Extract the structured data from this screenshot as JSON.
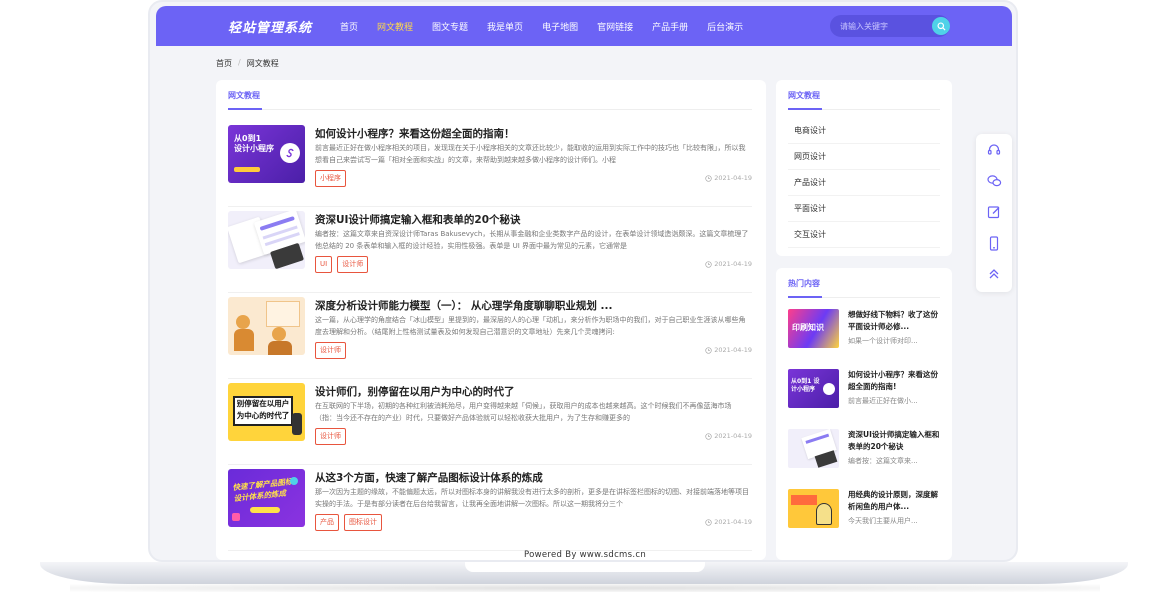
{
  "header": {
    "logo": "轻站管理系统",
    "nav": [
      {
        "label": "首页",
        "active": false
      },
      {
        "label": "网文教程",
        "active": true
      },
      {
        "label": "图文专题",
        "active": false
      },
      {
        "label": "我是单页",
        "active": false
      },
      {
        "label": "电子地图",
        "active": false
      },
      {
        "label": "官网链接",
        "active": false
      },
      {
        "label": "产品手册",
        "active": false
      },
      {
        "label": "后台演示",
        "active": false
      }
    ],
    "search_placeholder": "请输入关键字"
  },
  "breadcrumb": {
    "home": "首页",
    "sep": "/",
    "current": "网文教程"
  },
  "main": {
    "title": "网文教程",
    "articles": [
      {
        "title": "如何设计小程序？来看这份超全面的指南！",
        "desc": "前言最近正好在做小程序相关的项目，发现现在关于小程序相关的文章还比较少，能取收的运用到实际工作中的技巧也「比较有限」，所以我想看自己来尝试写一篇「相对全面和实战」的文章，来帮助到越来越多做小程序的设计师们。小程",
        "tags": [
          "小程序"
        ],
        "date": "2021-04-19",
        "thumb_text": [
          "从0到1",
          "设计小程序"
        ]
      },
      {
        "title": "资深UI设计师搞定输入框和表单的20个秘诀",
        "desc": "编者按：这篇文章来自资深设计师Taras Bakusevych，长期从事金融和企业类数字产品的设计，在表单设计领域造诣颇深。这篇文章梳理了他总结的 20 条表单和输入框的设计经验，实用性极强。表单是 UI 界面中最为常见的元素，它通常是",
        "tags": [
          "UI",
          "设计师"
        ],
        "date": "2021-04-19",
        "thumb_text": []
      },
      {
        "title": "深度分析设计师能力模型（一）： 从心理学角度聊聊职业规划 ...",
        "desc": "这一篇，从心理学的角度结合「冰山模型」里提到的，最深层的人的心理「动机」，来分析作为职场中的我们，对于自己职业生涯该从哪些角度去理解和分析。（结尾附上性格测试量表及如何发现自己潜意识的文章地址）先来几个灵魂拷问:",
        "tags": [
          "设计师"
        ],
        "date": "2021-04-19",
        "thumb_text": []
      },
      {
        "title": "设计师们，别停留在以用户为中心的时代了",
        "desc": "在互联网的下半场，初期的各种红利被消耗殆尽，用户变得越来越「伺候」，获取用户的成本也越来越高。这个时候我们不再像蓝海市场（指：当今还不存在的产业）时代，只要做好产品体验就可以轻松收获大批用户，为了生存和赚更多的",
        "tags": [
          "设计师"
        ],
        "date": "2021-04-19",
        "thumb_text": [
          "别停留在以用户",
          "为中心的时代了"
        ]
      },
      {
        "title": "从这3个方面，快速了解产品图标设计体系的炼成",
        "desc": "那一次因为主题的缘故，不能偏题太远，所以对图标本身的讲解我没有进行太多的剖析，更多是在讲标签栏图标的切图、对接前端落地等项目实操的手法。于是有部分读者在后台给我留言，让我再全面地讲解一次图标。所以这一期我将分三个",
        "tags": [
          "产品",
          "图标设计"
        ],
        "date": "2021-04-19",
        "thumb_text": [
          "快速了解产品图标",
          "设计体系的炼成"
        ]
      }
    ]
  },
  "sidebar": {
    "category_title": "网文教程",
    "categories": [
      "电商设计",
      "网页设计",
      "产品设计",
      "平面设计",
      "交互设计"
    ],
    "hot_title": "热门内容",
    "hot": [
      {
        "title": "想做好线下物料？收了这份平面设计师必修...",
        "desc": "如果一个设计师对印...",
        "thumb_text": "印刷知识"
      },
      {
        "title": "如何设计小程序？来看这份超全面的指南!",
        "desc": "前言最近正好在做小...",
        "thumb_text": "从0到1 设计小程序"
      },
      {
        "title": "资深UI设计师搞定输入框和表单的20个秘诀",
        "desc": "编者按：这篇文章来...",
        "thumb_text": ""
      },
      {
        "title": "用经典的设计原则，深度解析闲鱼的用户体...",
        "desc": "今天我们主要从用户...",
        "thumb_text": ""
      }
    ]
  },
  "float_bar": [
    "headset-icon",
    "wechat-icon",
    "edit-icon",
    "mobile-icon",
    "back-to-top-icon"
  ],
  "footer": "Powered By www.sdcms.cn",
  "colors": {
    "brand": "#6c63f5",
    "tag": "#e8553e",
    "search_btn": "#4fd1e8",
    "nav_active": "#ffd94a"
  }
}
